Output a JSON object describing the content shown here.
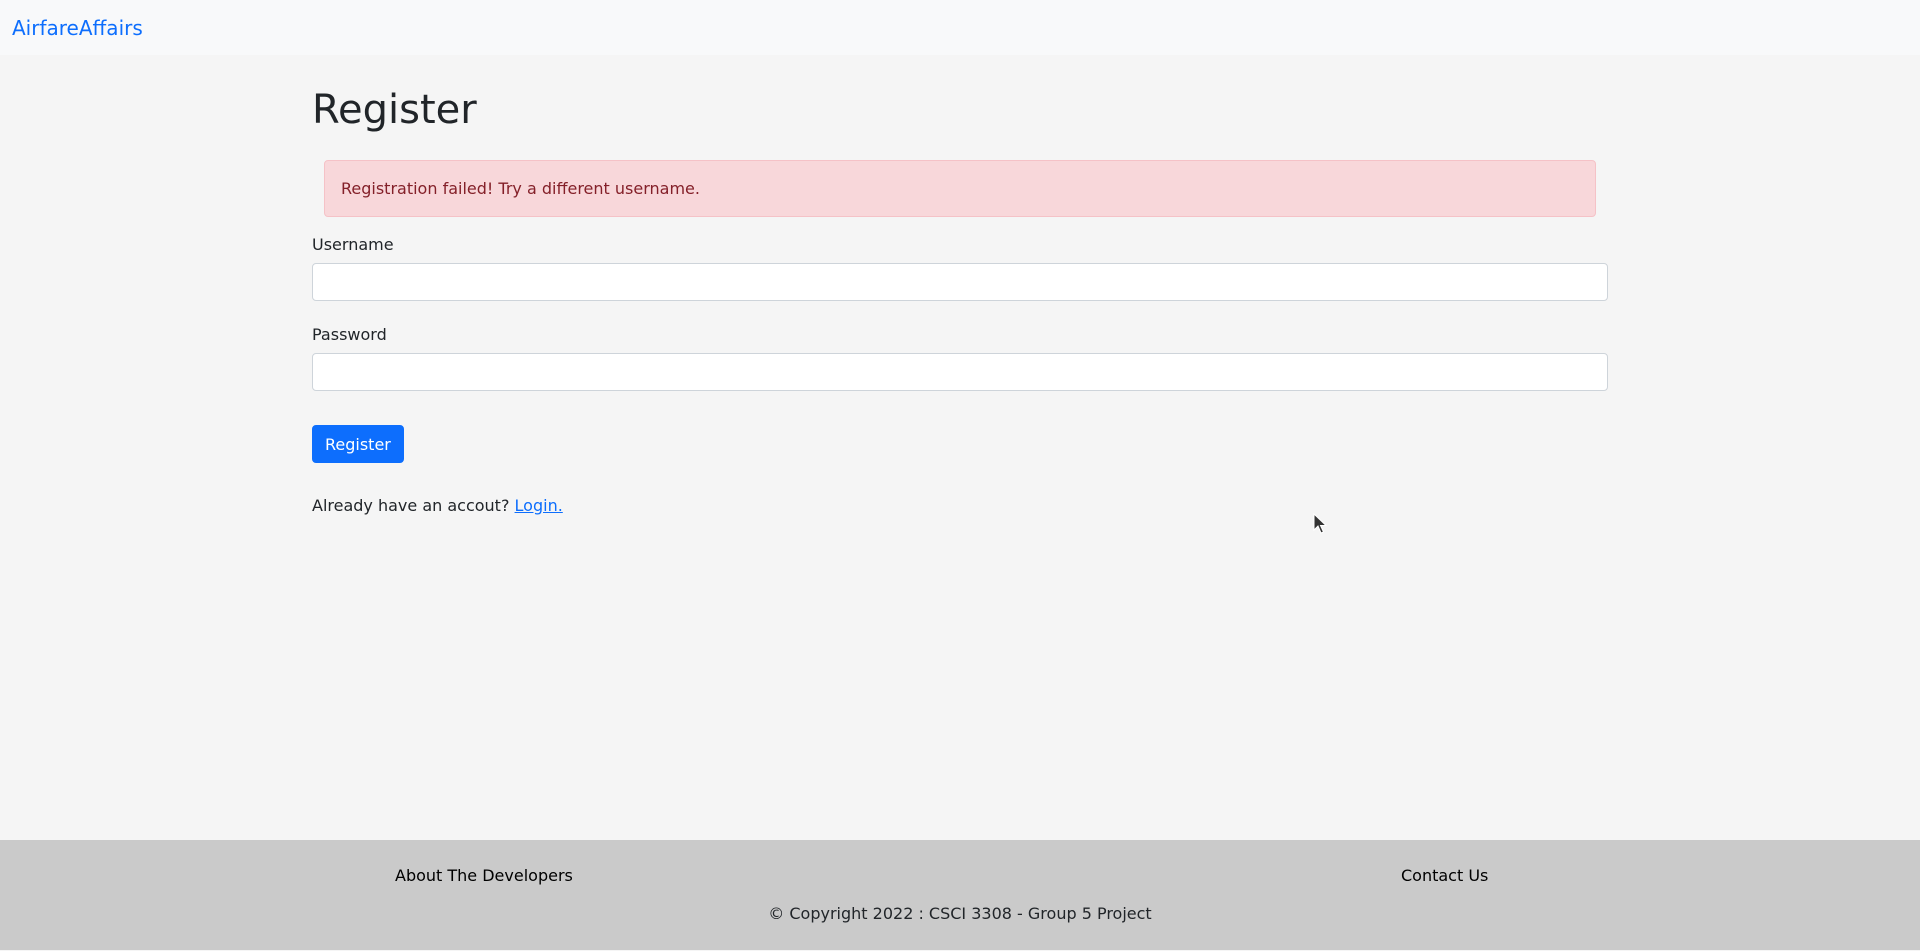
{
  "navbar": {
    "brand": "AirfareAffairs"
  },
  "main": {
    "title": "Register",
    "alert": "Registration failed! Try a different username.",
    "username_label": "Username",
    "username_value": "",
    "password_label": "Password",
    "password_value": "",
    "submit_label": "Register",
    "login_prompt": "Already have an accout?",
    "login_link": "Login."
  },
  "footer": {
    "about": "About The Developers",
    "contact": "Contact Us",
    "copyright": "© Copyright 2022 : CSCI 3308 - Group 5 Project"
  },
  "colors": {
    "accent": "#0d6efd",
    "alert_bg": "#f8d7da",
    "alert_text": "#842029",
    "footer_bg": "#cacaca"
  }
}
